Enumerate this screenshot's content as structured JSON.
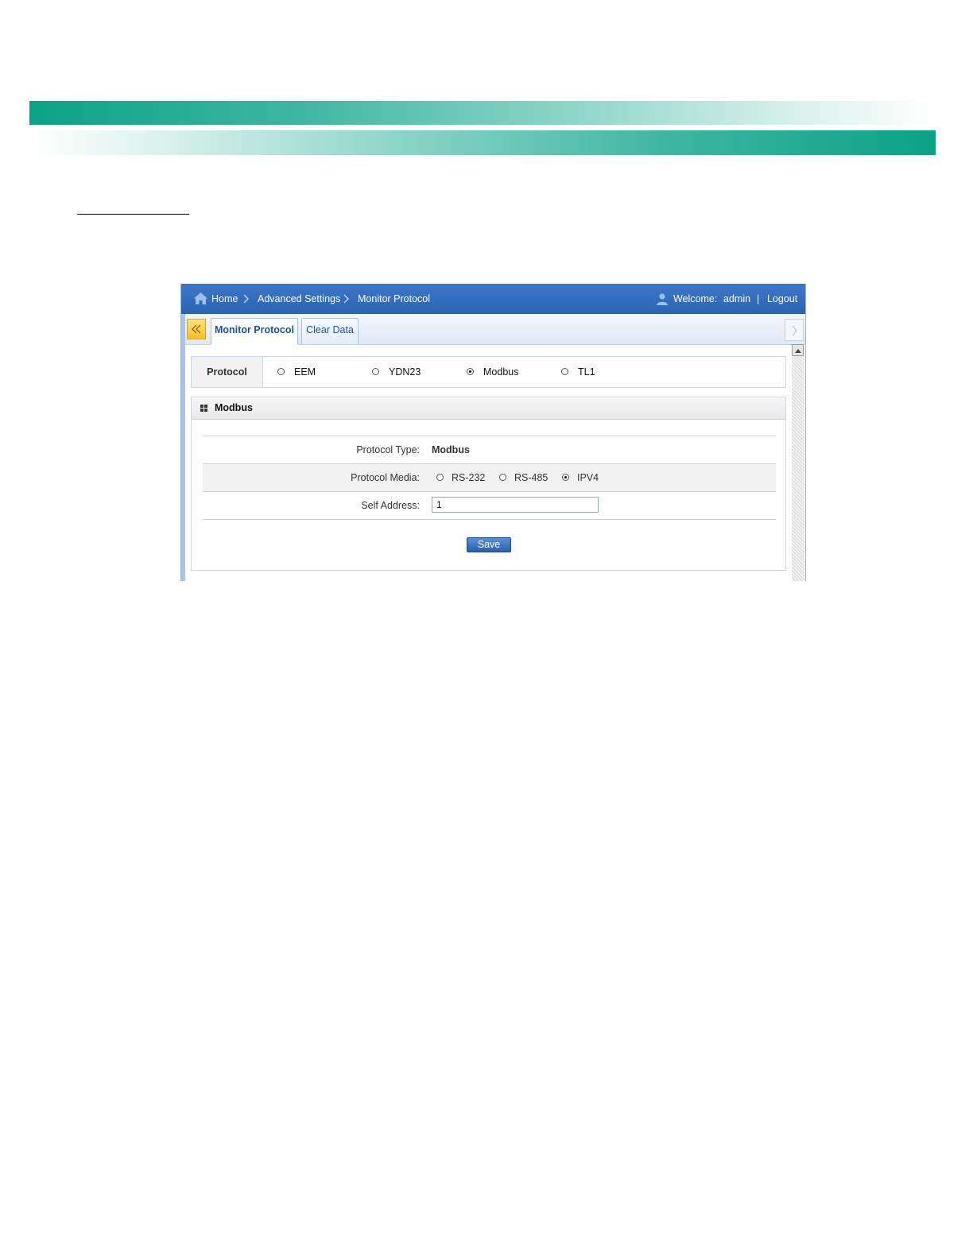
{
  "breadcrumb": {
    "home": "Home",
    "section": "Advanced Settings",
    "page": "Monitor Protocol"
  },
  "user": {
    "welcome": "Welcome:",
    "name": "admin",
    "separator": "|",
    "logout": "Logout"
  },
  "tabs": [
    {
      "label": "Monitor Protocol",
      "active": true
    },
    {
      "label": "Clear Data",
      "active": false
    }
  ],
  "protocol": {
    "label": "Protocol",
    "options": [
      "EEM",
      "YDN23",
      "Modbus",
      "TL1"
    ],
    "selected": "Modbus"
  },
  "panel": {
    "title": "Modbus",
    "protocol_type_label": "Protocol Type:",
    "protocol_type_value": "Modbus",
    "media_label": "Protocol Media:",
    "media_options": [
      "RS-232",
      "RS-485",
      "IPV4"
    ],
    "media_selected": "IPV4",
    "self_address_label": "Self Address:",
    "self_address_value": "1",
    "save_label": "Save"
  },
  "colors": {
    "brand_green": "#0aa287",
    "header_blue": "#2b63b3",
    "tab_text": "#1d4f9f",
    "collapse_yellow": "#f5be2a"
  },
  "icons": {
    "home": "home-icon",
    "user": "user-icon",
    "collapse": "double-chevron-left-icon",
    "scroll_right": "chevron-right-icon",
    "panel": "grid-icon"
  }
}
